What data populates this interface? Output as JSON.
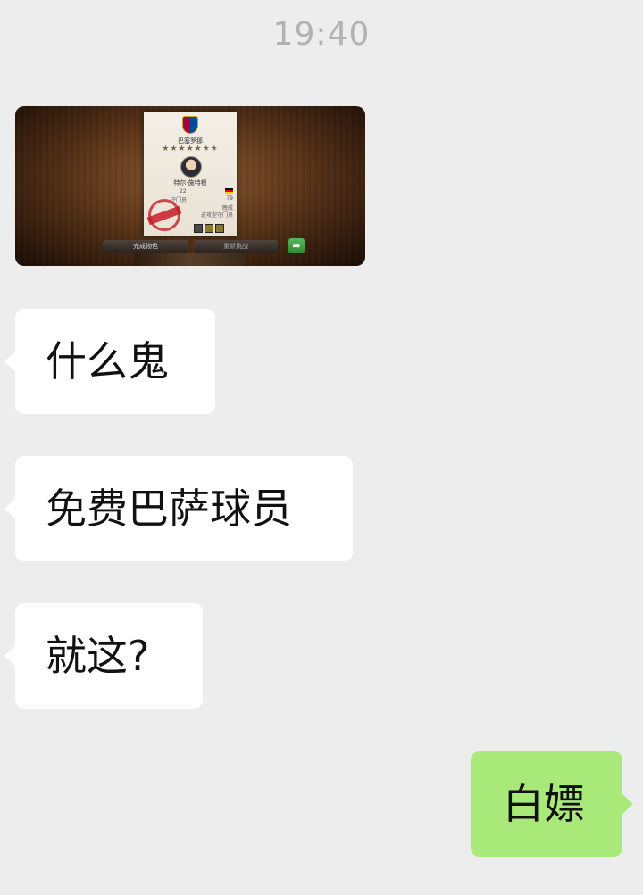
{
  "timestamp": "19:40",
  "image_message": {
    "club": "巴塞罗那",
    "stars": "★★★★★★★",
    "player_name": "特尔·施特根",
    "number": "22",
    "position": "守门员",
    "rating": "79",
    "tag": "晚成",
    "role": "进攻型守门员",
    "left_button": "完成物色",
    "right_button": "重新挑战",
    "share_icon": "share-arrow-icon"
  },
  "messages": [
    {
      "side": "received",
      "text": "什么鬼"
    },
    {
      "side": "received",
      "text": "免费巴萨球员"
    },
    {
      "side": "received",
      "text": "就这?"
    },
    {
      "side": "sent",
      "text": "白嫖"
    }
  ],
  "colors": {
    "background": "#ededed",
    "received_bubble": "#ffffff",
    "sent_bubble": "#a9e97a",
    "timestamp": "#b2b2b2"
  }
}
